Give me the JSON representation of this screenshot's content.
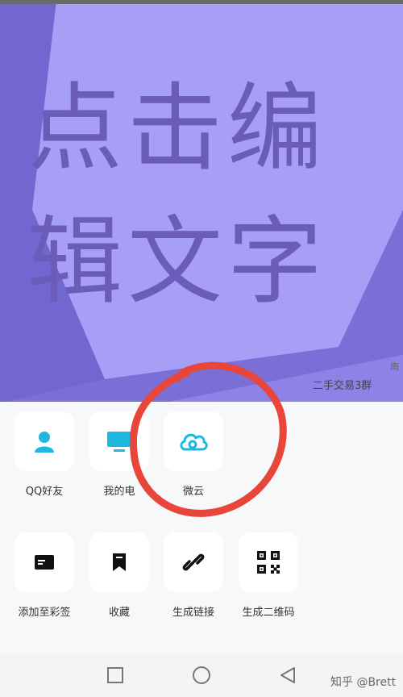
{
  "poster": {
    "line1": "点击编",
    "line2": "辑文字",
    "colors": {
      "light": "#a79ff6",
      "mid": "#9a8ff2",
      "dark": "#7266d0",
      "text": "#6a5cb8"
    }
  },
  "background_labels": {
    "group": "二手交易3群",
    "group_partial": "南"
  },
  "share_row1": [
    {
      "label": "QQ好友",
      "icon": "qq-friend-person-icon"
    },
    {
      "label": "我的电",
      "icon": "computer-monitor-icon"
    },
    {
      "label": "微云",
      "icon": "weiyun-cloud-icon"
    }
  ],
  "share_row2": [
    {
      "label": "添加至彩签",
      "icon": "tag-card-icon"
    },
    {
      "label": "收藏",
      "icon": "bookmark-icon"
    },
    {
      "label": "生成链接",
      "icon": "link-icon"
    },
    {
      "label": "生成二维码",
      "icon": "qr-code-icon"
    }
  ],
  "colors": {
    "accent_cyan": "#1fb7e0",
    "icon_dark": "#111111",
    "annotation_red": "#e8463b"
  },
  "watermark": "知乎 @Brett"
}
